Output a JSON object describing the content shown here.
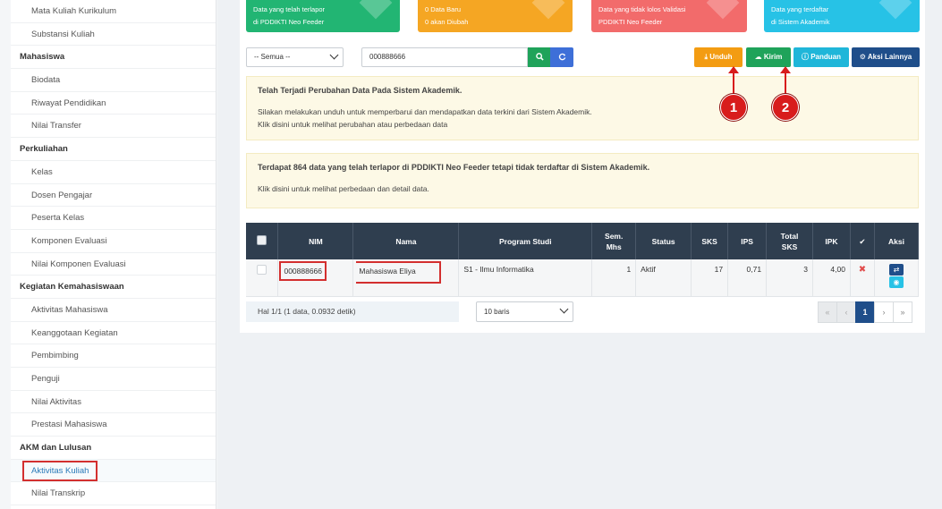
{
  "sidebar": {
    "items": [
      {
        "type": "item",
        "label": "Mata Kuliah Kurikulum"
      },
      {
        "type": "item",
        "label": "Substansi Kuliah"
      },
      {
        "type": "head",
        "label": "Mahasiswa"
      },
      {
        "type": "item",
        "label": "Biodata"
      },
      {
        "type": "item",
        "label": "Riwayat Pendidikan"
      },
      {
        "type": "item",
        "label": "Nilai Transfer"
      },
      {
        "type": "head",
        "label": "Perkuliahan"
      },
      {
        "type": "item",
        "label": "Kelas"
      },
      {
        "type": "item",
        "label": "Dosen Pengajar"
      },
      {
        "type": "item",
        "label": "Peserta Kelas"
      },
      {
        "type": "item",
        "label": "Komponen Evaluasi"
      },
      {
        "type": "item",
        "label": "Nilai Komponen Evaluasi"
      },
      {
        "type": "head",
        "label": "Kegiatan Kemahasiswaan"
      },
      {
        "type": "item",
        "label": "Aktivitas Mahasiswa"
      },
      {
        "type": "item",
        "label": "Keanggotaan Kegiatan"
      },
      {
        "type": "item",
        "label": "Pembimbing"
      },
      {
        "type": "item",
        "label": "Penguji"
      },
      {
        "type": "item",
        "label": "Nilai Aktivitas"
      },
      {
        "type": "item",
        "label": "Prestasi Mahasiswa"
      },
      {
        "type": "head",
        "label": "AKM dan Lulusan"
      },
      {
        "type": "item",
        "label": "Aktivitas Kuliah",
        "active": true
      },
      {
        "type": "item",
        "label": "Nilai Transkrip"
      }
    ]
  },
  "tiles": {
    "green": {
      "line1": "Data yang telah terlapor",
      "line2": "di PDDIKTI Neo Feeder"
    },
    "orange": {
      "line1": "0 Data Baru",
      "line2": "0 akan Diubah"
    },
    "red": {
      "line1": "Data yang tidak lolos Validasi",
      "line2": "PDDIKTI Neo Feeder"
    },
    "cyan": {
      "line1": "Data yang terdaftar",
      "line2": "di Sistem Akademik"
    }
  },
  "toolbar": {
    "filter_value": "-- Semua --",
    "search_value": "000888666",
    "unduh_label": "Unduh",
    "kirim_label": "Kirim",
    "panduan_label": "Panduan",
    "aksi_label": "Aksi Lainnya"
  },
  "annotations": {
    "one": "1",
    "two": "2"
  },
  "alert1": {
    "title": "Telah Terjadi Perubahan Data Pada Sistem Akademik.",
    "line1": "Silakan melakukan unduh untuk memperbarui dan mendapatkan data terkini dari Sistem Akademik.",
    "line2": "Klik disini untuk melihat perubahan atau perbedaan data"
  },
  "alert2": {
    "title": "Terdapat 864 data yang telah terlapor di PDDIKTI Neo Feeder tetapi tidak terdaftar di Sistem Akademik.",
    "line1": "Klik disini untuk melihat perbedaan dan detail data."
  },
  "table": {
    "headers": {
      "nim": "NIM",
      "nama": "Nama",
      "prodi": "Program Studi",
      "sem_1": "Sem.",
      "sem_2": "Mhs",
      "status": "Status",
      "sks": "SKS",
      "ips": "IPS",
      "total_1": "Total",
      "total_2": "SKS",
      "ipk": "IPK",
      "aksi": "Aksi"
    },
    "row": {
      "nim": "000888666",
      "nama": "Mahasiswa Eliya",
      "prodi": "S1 - Ilmu Informatika",
      "sem": "1",
      "status": "Aktif",
      "sks": "17",
      "ips": "0,71",
      "total_sks": "3",
      "ipk": "4,00"
    }
  },
  "footer": {
    "info": "Hal 1/1 (1 data, 0.0932 detik)",
    "per_page": "10 baris",
    "pages": {
      "first": "«",
      "prev": "‹",
      "current": "1",
      "next": "›",
      "last": "»"
    }
  }
}
